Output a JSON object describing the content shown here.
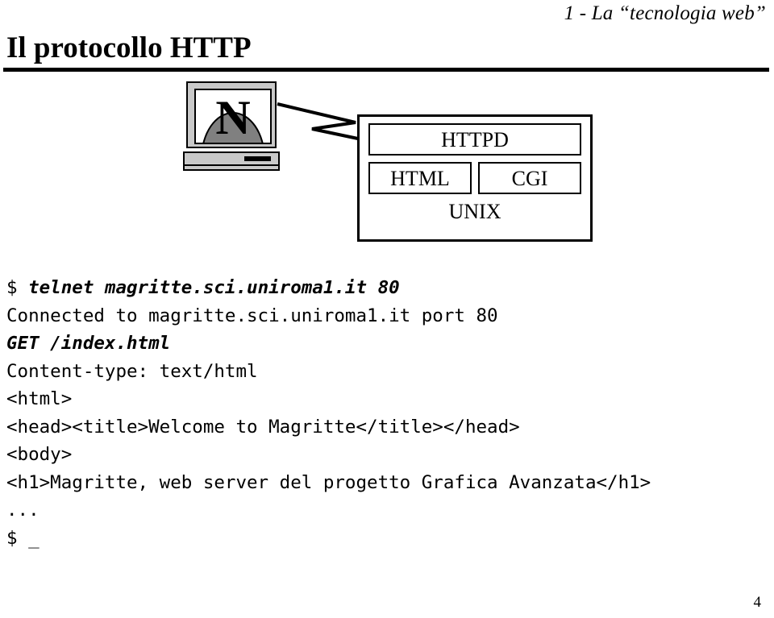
{
  "header": {
    "section_label": "1 - La “tecnologia web”"
  },
  "title": {
    "text": "Il protocollo HTTP"
  },
  "diagram": {
    "client": {
      "logo_letter": "N",
      "logo_name": "netscape-logo"
    },
    "server": {
      "httpd_label": "HTTPD",
      "html_label": "HTML",
      "cgi_label": "CGI",
      "os_label": "UNIX"
    },
    "connection": {
      "style": "lightning-bolt"
    }
  },
  "terminal": {
    "lines": [
      {
        "id": "line-1",
        "prompt": "$ ",
        "text": "telnet magritte.sci.uniroma1.it 80",
        "emphasis": "command"
      },
      {
        "id": "line-2",
        "prompt": "",
        "text": "Connected to magritte.sci.uniroma1.it port 80",
        "emphasis": "output"
      },
      {
        "id": "line-3",
        "prompt": "",
        "text": "GET /index.html",
        "emphasis": "command"
      },
      {
        "id": "line-4",
        "prompt": "",
        "text": "Content-type: text/html",
        "emphasis": "output"
      },
      {
        "id": "line-5",
        "prompt": "",
        "text": "<html>",
        "emphasis": "output"
      },
      {
        "id": "line-6",
        "prompt": "",
        "text": "<head><title>Welcome to Magritte</title></head>",
        "emphasis": "output"
      },
      {
        "id": "line-7",
        "prompt": "",
        "text": "<body>",
        "emphasis": "output"
      },
      {
        "id": "line-8",
        "prompt": "",
        "text": "<h1>Magritte, web server del progetto Grafica Avanzata</h1>",
        "emphasis": "output"
      },
      {
        "id": "line-9",
        "prompt": "",
        "text": "...",
        "emphasis": "output"
      },
      {
        "id": "line-10",
        "prompt": "",
        "text": "$ _",
        "emphasis": "output"
      }
    ]
  },
  "footer": {
    "page_number": "4"
  },
  "colors": {
    "background": "#ffffff",
    "foreground": "#000000",
    "case_gray": "#c9c9c9",
    "logo_dome_gray": "#808080"
  }
}
